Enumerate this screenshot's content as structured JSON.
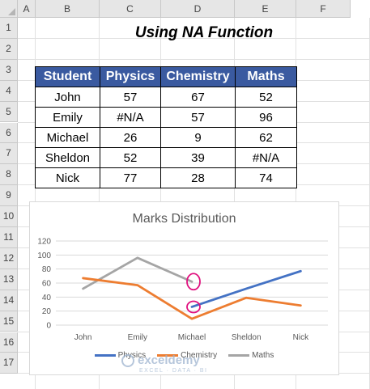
{
  "sheet": {
    "columns": [
      "A",
      "B",
      "C",
      "D",
      "E",
      "F"
    ],
    "rows": [
      "1",
      "2",
      "3",
      "4",
      "5",
      "6",
      "7",
      "8",
      "9",
      "10",
      "11",
      "12",
      "13",
      "14",
      "15",
      "16",
      "17"
    ],
    "title": "Using NA Function"
  },
  "table": {
    "headers": [
      "Student",
      "Physics",
      "Chemistry",
      "Maths"
    ],
    "rows": [
      [
        "John",
        "57",
        "67",
        "52"
      ],
      [
        "Emily",
        "#N/A",
        "57",
        "96"
      ],
      [
        "Michael",
        "26",
        "9",
        "62"
      ],
      [
        "Sheldon",
        "52",
        "39",
        "#N/A"
      ],
      [
        "Nick",
        "77",
        "28",
        "74"
      ]
    ]
  },
  "chart_data": {
    "type": "line",
    "title": "Marks Distribution",
    "categories": [
      "John",
      "Emily",
      "Michael",
      "Sheldon",
      "Nick"
    ],
    "ylim": [
      0,
      120
    ],
    "yticks": [
      "0",
      "20",
      "40",
      "60",
      "80",
      "100",
      "120"
    ],
    "grid": true,
    "legend": "bottom",
    "series": [
      {
        "name": "Physics",
        "color": "#4472c4",
        "values": [
          null,
          null,
          26,
          52,
          77
        ]
      },
      {
        "name": "Chemistry",
        "color": "#ed7d31",
        "values": [
          67,
          57,
          9,
          39,
          28
        ]
      },
      {
        "name": "Maths",
        "color": "#a5a5a5",
        "values": [
          52,
          96,
          62,
          null,
          null
        ]
      }
    ],
    "highlights": [
      {
        "category": "Michael",
        "value": 62,
        "color": "#e0117f"
      },
      {
        "category": "Michael",
        "value": 26,
        "color": "#e0117f"
      }
    ]
  },
  "watermark": {
    "name": "exceldemy",
    "tagline": "EXCEL · DATA · BI"
  }
}
